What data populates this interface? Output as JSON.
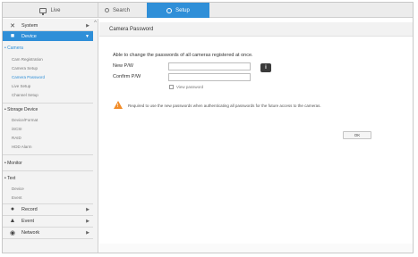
{
  "topbar": {
    "live_label": "Live",
    "search_label": "Search",
    "setup_label": "Setup"
  },
  "sidebar": {
    "system_label": "System",
    "device_label": "Device",
    "camera_group": "Camera",
    "camera_items": [
      "Cam Registration",
      "Camera Setup",
      "Camera Password",
      "Live Setup",
      "Channel Setup"
    ],
    "storage_group": "Storage Device",
    "storage_items": [
      "Device/Format",
      "iSCSI",
      "RAID",
      "HDD Alarm"
    ],
    "monitor_group": "Monitor",
    "text_group": "Text",
    "text_items": [
      "Device",
      "Event"
    ],
    "record_label": "Record",
    "event_label": "Event",
    "network_label": "Network"
  },
  "main": {
    "title": "Camera Password",
    "description": "Able to change the passwords of all cameras registered at once.",
    "new_pw_label": "New P/W",
    "confirm_pw_label": "Confirm P/W",
    "new_pw_value": "",
    "confirm_pw_value": "",
    "view_password_label": "View password",
    "warning_text": "Required to use the new passwords when authenticating all passwords for the future access to the cameras.",
    "ok_label": "OK",
    "info_glyph": "i"
  },
  "colors": {
    "accent": "#2f8fd8",
    "warning": "#f28c28"
  }
}
